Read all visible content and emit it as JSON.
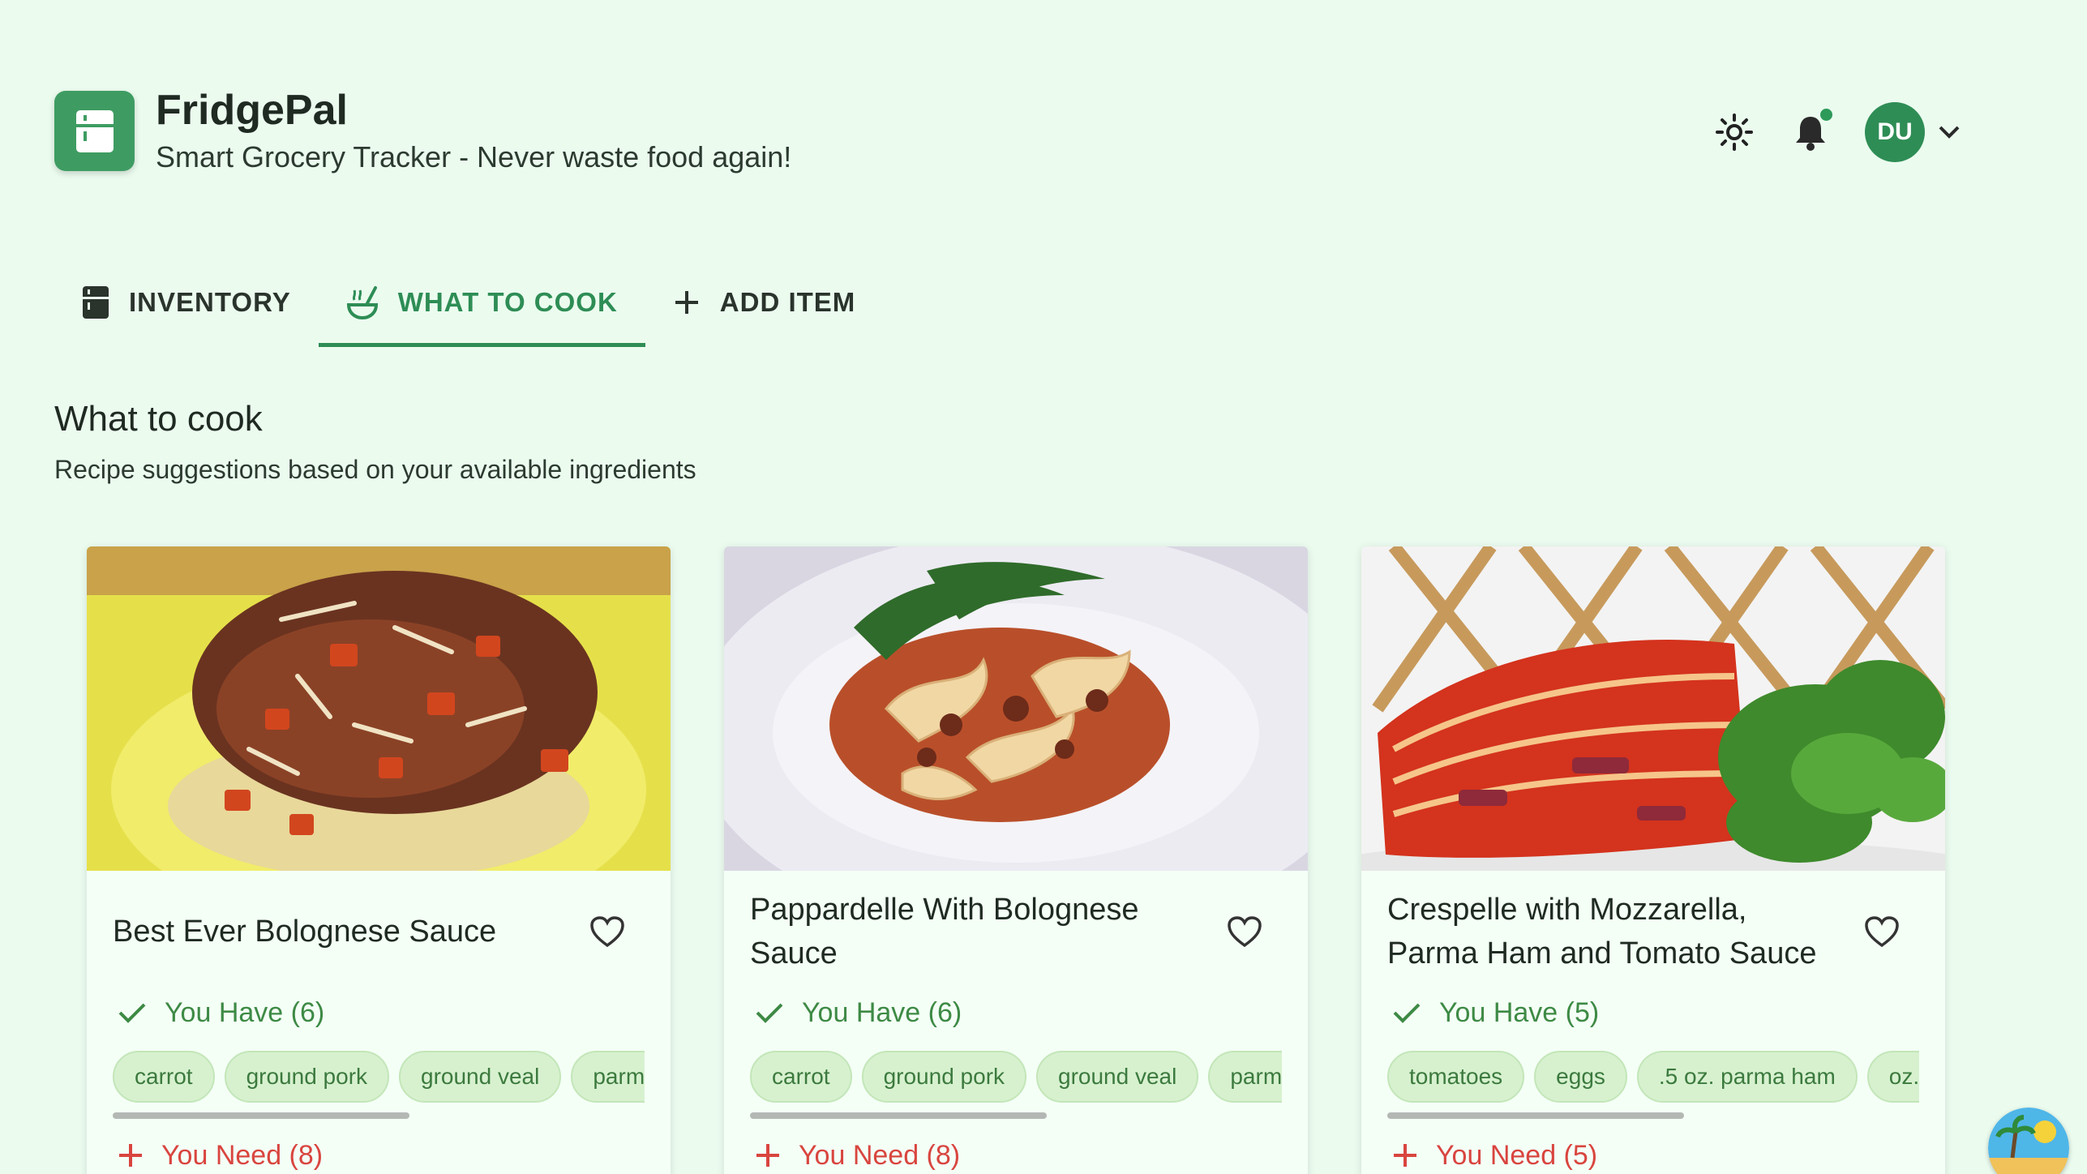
{
  "app": {
    "name": "FridgePal",
    "tagline": "Smart Grocery Tracker - Never waste food again!",
    "logo_icon": "fridge-icon",
    "accent": "#2e8d55"
  },
  "header": {
    "theme_icon": "sun-icon",
    "notifications_icon": "bell-icon",
    "avatar_initials": "DU",
    "menu_icon": "chevron-down-icon"
  },
  "tabs": [
    {
      "label": "INVENTORY",
      "icon": "fridge-icon",
      "active": false
    },
    {
      "label": "WHAT TO COOK",
      "icon": "soup-icon",
      "active": true
    },
    {
      "label": "ADD ITEM",
      "icon": "plus-icon",
      "active": false
    }
  ],
  "section": {
    "title": "What to cook",
    "subtitle": "Recipe suggestions based on your available ingredients"
  },
  "recipes": [
    {
      "title": "Best Ever Bolognese Sauce",
      "have_label": "You Have (6)",
      "have": [
        "carrot",
        "ground pork",
        "ground veal",
        "parmes"
      ],
      "need_label": "You Need (8)"
    },
    {
      "title": "Pappardelle With Bolognese Sauce",
      "have_label": "You Have (6)",
      "have": [
        "carrot",
        "ground pork",
        "ground veal",
        "parmes"
      ],
      "need_label": "You Need (8)"
    },
    {
      "title": "Crespelle with Mozzarella, Parma Ham and Tomato Sauce",
      "have_label": "You Have (5)",
      "have": [
        "tomatoes",
        "eggs",
        ".5 oz. parma ham",
        "oz. m"
      ],
      "need_label": "You Need (5)"
    }
  ]
}
